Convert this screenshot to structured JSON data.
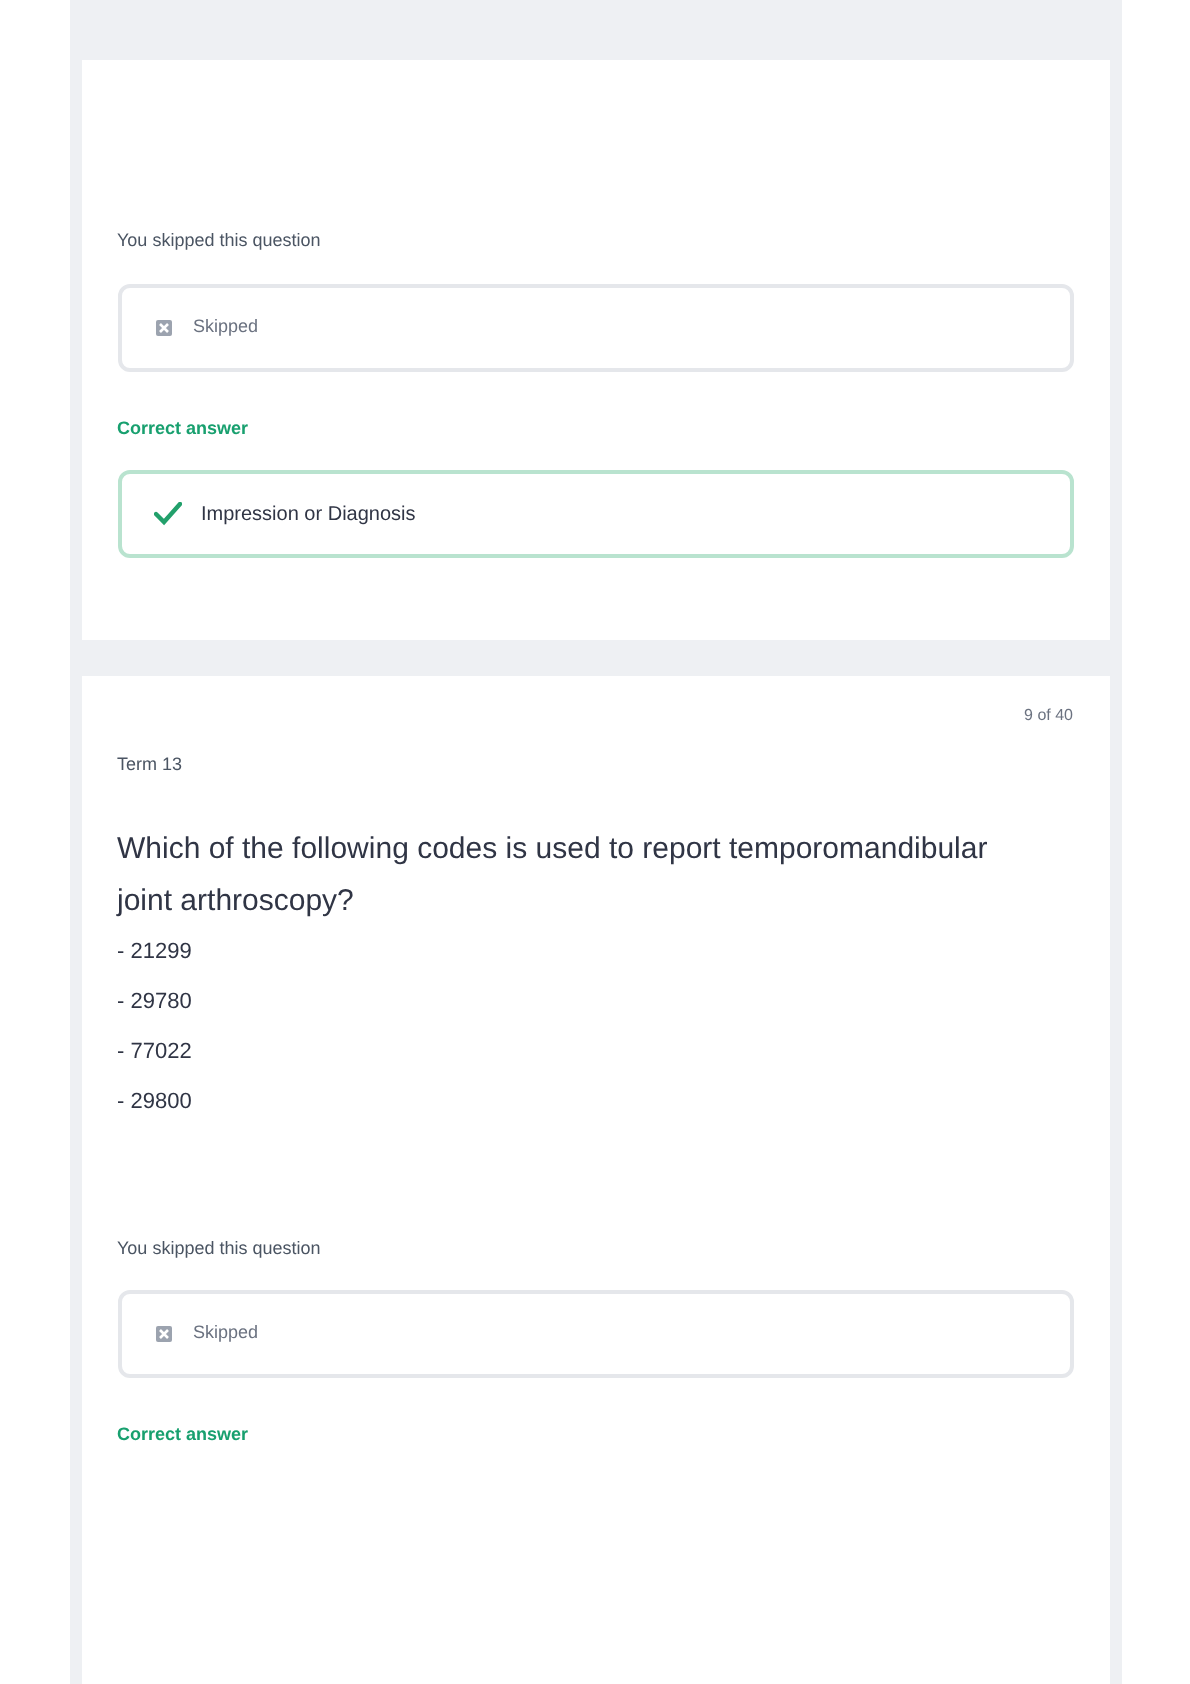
{
  "cards": [
    {
      "prompt": "You skipped this question",
      "answer": {
        "kind": "skipped",
        "text": "Skipped"
      },
      "correct_label": "Correct answer",
      "correct": {
        "text": "Impression or Diagnosis"
      }
    },
    {
      "counter": "9 of 40",
      "term": "Term 13",
      "question": "Which of the following codes is used to report temporomandibular joint arthroscopy?",
      "options": [
        "- 21299",
        "- 29780",
        "- 77022",
        "- 29800"
      ],
      "prompt": "You skipped this question",
      "answer": {
        "kind": "skipped",
        "text": "Skipped"
      },
      "correct_label": "Correct answer"
    }
  ]
}
